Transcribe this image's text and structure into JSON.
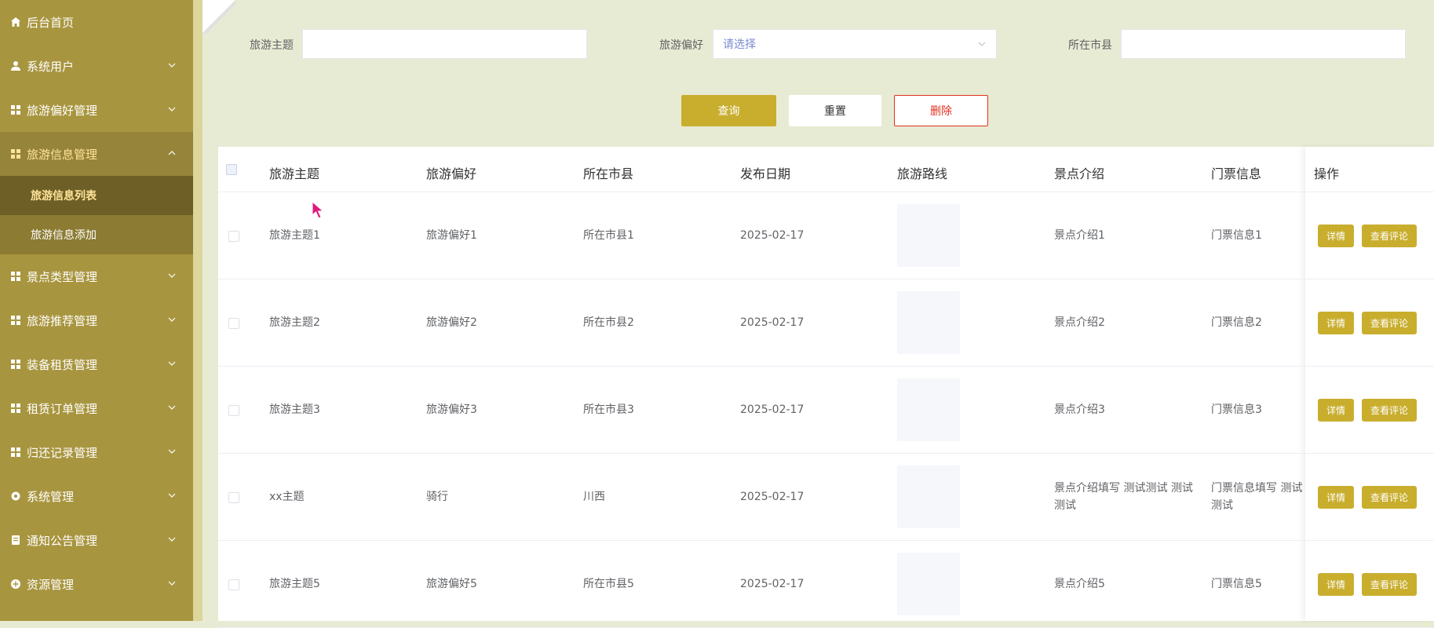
{
  "sidebar": {
    "items": [
      {
        "label": "后台首页",
        "icon": "home-icon"
      },
      {
        "label": "系统用户",
        "icon": "user-icon"
      },
      {
        "label": "旅游偏好管理",
        "icon": "grid-icon"
      },
      {
        "label": "旅游信息管理",
        "icon": "grid-icon"
      },
      {
        "label": "景点类型管理",
        "icon": "grid-icon"
      },
      {
        "label": "旅游推荐管理",
        "icon": "grid-icon"
      },
      {
        "label": "装备租赁管理",
        "icon": "grid-icon"
      },
      {
        "label": "租赁订单管理",
        "icon": "grid-icon"
      },
      {
        "label": "归还记录管理",
        "icon": "grid-icon"
      },
      {
        "label": "系统管理",
        "icon": "gear-icon"
      },
      {
        "label": "通知公告管理",
        "icon": "document-icon"
      },
      {
        "label": "资源管理",
        "icon": "plus-circle-icon"
      }
    ],
    "sub_items": [
      {
        "label": "旅游信息列表"
      },
      {
        "label": "旅游信息添加"
      }
    ]
  },
  "search": {
    "theme_label": "旅游主题",
    "theme_value": "",
    "preference_label": "旅游偏好",
    "preference_placeholder": "请选择",
    "city_label": "所在市县",
    "city_value": "",
    "search_button": "查询",
    "reset_button": "重置",
    "delete_button": "删除"
  },
  "table": {
    "headers": [
      "旅游主题",
      "旅游偏好",
      "所在市县",
      "发布日期",
      "旅游路线",
      "景点介绍",
      "门票信息",
      "操作"
    ],
    "rows": [
      {
        "theme": "旅游主题1",
        "preference": "旅游偏好1",
        "city": "所在市县1",
        "date": "2025-02-17",
        "intro": "景点介绍1",
        "ticket": "门票信息1"
      },
      {
        "theme": "旅游主题2",
        "preference": "旅游偏好2",
        "city": "所在市县2",
        "date": "2025-02-17",
        "intro": "景点介绍2",
        "ticket": "门票信息2"
      },
      {
        "theme": "旅游主题3",
        "preference": "旅游偏好3",
        "city": "所在市县3",
        "date": "2025-02-17",
        "intro": "景点介绍3",
        "ticket": "门票信息3"
      },
      {
        "theme": "xx主题",
        "preference": "骑行",
        "city": "川西",
        "date": "2025-02-17",
        "intro": "景点介绍填写 测试测试 测试测试",
        "ticket": "门票信息填写 测试测试"
      },
      {
        "theme": "旅游主题5",
        "preference": "旅游偏好5",
        "city": "所在市县5",
        "date": "2025-02-17",
        "intro": "景点介绍5",
        "ticket": "门票信息5"
      }
    ],
    "detail_button": "详情",
    "comment_button": "查看评论"
  },
  "colors": {
    "sidebar_bg": "#a8953f",
    "accent": "#c9ae2e",
    "danger": "#e0301e",
    "active_text": "#ffe39a"
  }
}
